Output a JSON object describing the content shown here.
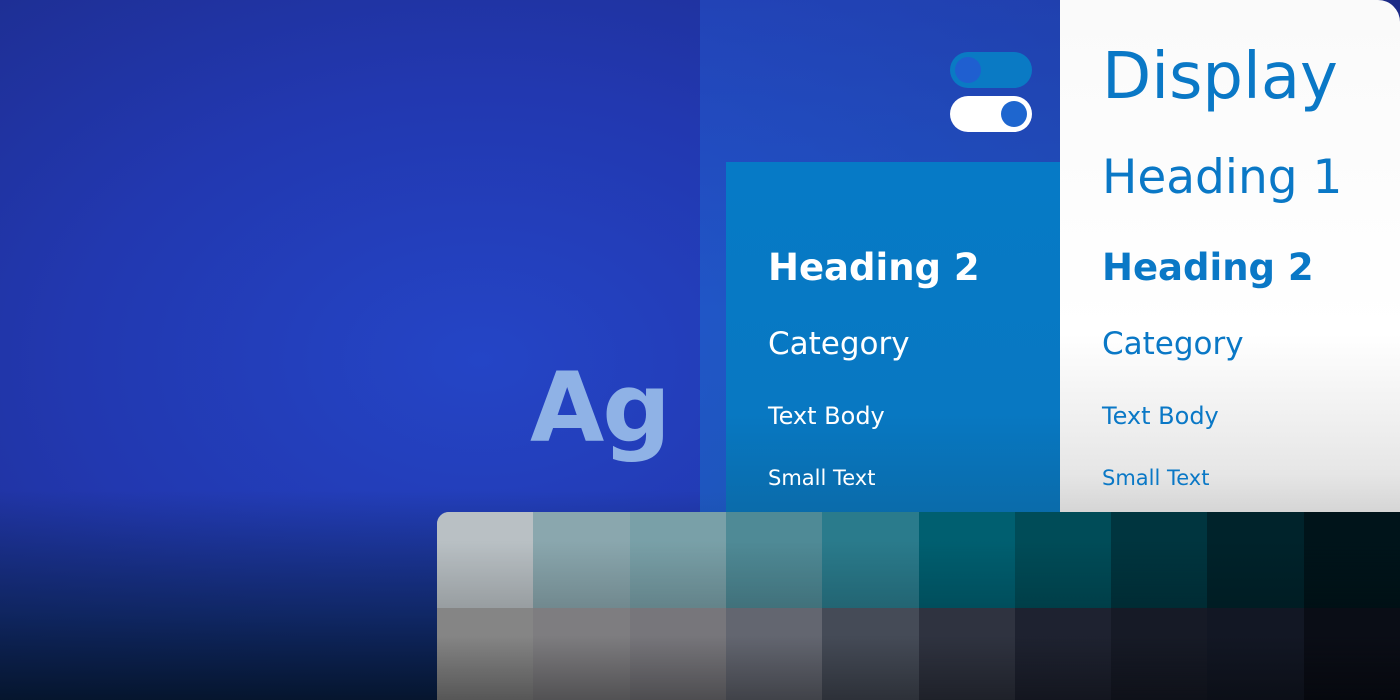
{
  "accent_colors": {
    "primary_blue": "#0a78c6",
    "background_blue": "#2238b0",
    "white": "#ffffff"
  },
  "toggles": [
    {
      "name": "toggle-off",
      "state": "off"
    },
    {
      "name": "toggle-on",
      "state": "on"
    }
  ],
  "glyph_sample": "Ag",
  "blue_panel": {
    "heading2": "Heading 2",
    "category": "Category",
    "text_body": "Text Body",
    "small_text": "Small Text"
  },
  "white_panel": {
    "display": "Display",
    "heading1": "Heading 1",
    "heading2": "Heading 2",
    "category": "Category",
    "text_body": "Text Body",
    "small_text": "Small Text"
  },
  "palette": {
    "top_row": [
      "#b9c0c4",
      "#8aa7ae",
      "#79a0a8",
      "#4f8a96",
      "#2a7b8c",
      "#005f70",
      "#004c58",
      "#00353f",
      "#00232b",
      "#00141a"
    ],
    "bottom_row": [
      "#858585",
      "#7e7d80",
      "#77767b",
      "#636670",
      "#454b57",
      "#2f3340",
      "#1e2230",
      "#161a26",
      "#121724",
      "#0a0d16"
    ]
  }
}
